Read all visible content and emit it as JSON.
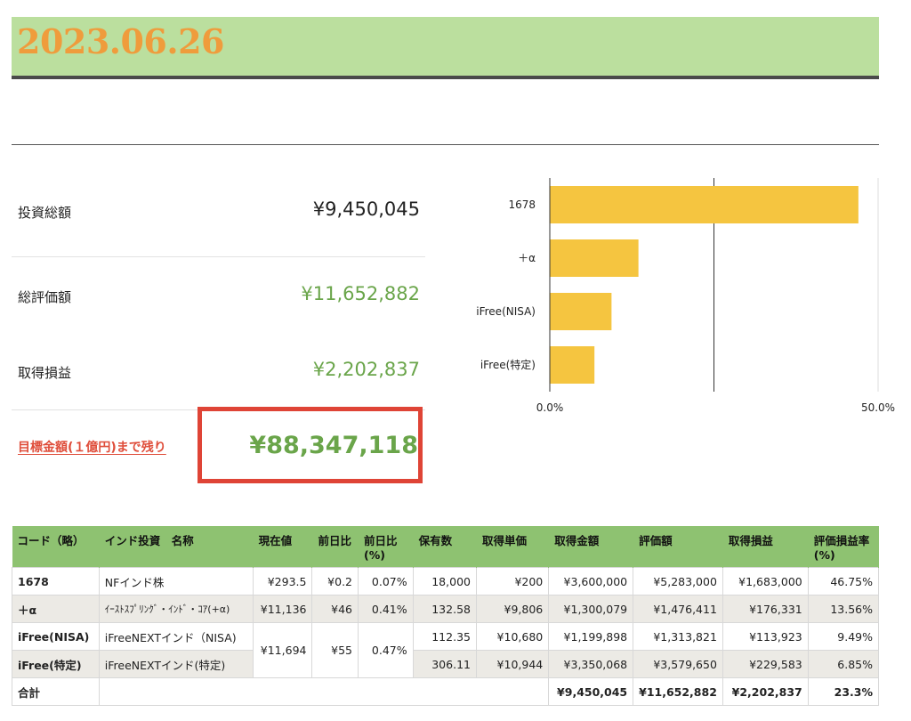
{
  "header": {
    "date": "2023.06.26"
  },
  "summary": {
    "invest_label": "投資総額",
    "invest_value": "¥9,450,045",
    "eval_label": "総評価額",
    "eval_value": "¥11,652,882",
    "gain_label": "取得損益",
    "gain_value": "¥2,202,837",
    "goal_label": "目標金額(１億円)まで残り",
    "goal_value": "¥88,347,118"
  },
  "chart_data": {
    "type": "bar",
    "orientation": "horizontal",
    "categories": [
      "1678",
      "＋α",
      "iFree(NISA)",
      "iFree(特定)"
    ],
    "values": [
      47.0,
      13.5,
      9.4,
      6.8
    ],
    "x_ticks": [
      "0.0%",
      "50.0%"
    ],
    "xlim": [
      0,
      50
    ],
    "color": "#f5c540",
    "gridline_at": 25
  },
  "table": {
    "headers": [
      "コード（略）",
      "インド投資　名称",
      "現在値",
      "前日比",
      "前日比\n(%)",
      "保有数",
      "取得単価",
      "取得金額",
      "評価額",
      "取得損益",
      "評価損益率\n(%)"
    ],
    "rows": [
      {
        "code": "1678",
        "name": "NFインド株",
        "price": "¥293.5",
        "diff": "¥0.2",
        "diff_pct": "0.07%",
        "qty": "18,000",
        "unit_cost": "¥200",
        "cost": "¥3,600,000",
        "value": "¥5,283,000",
        "gain": "¥1,683,000",
        "gain_pct": "46.75%"
      },
      {
        "code": "＋α",
        "name": "ｲｰｽﾄｽﾌﾟﾘﾝｸﾞ・ｲﾝﾄﾞ・ｺｱ(+α)",
        "price": "¥11,136",
        "diff": "¥46",
        "diff_pct": "0.41%",
        "qty": "132.58",
        "unit_cost": "¥9,806",
        "cost": "¥1,300,079",
        "value": "¥1,476,411",
        "gain": "¥176,331",
        "gain_pct": "13.56%"
      },
      {
        "code": "iFree(NISA)",
        "name": "iFreeNEXTインド（NISA)",
        "qty": "112.35",
        "unit_cost": "¥10,680",
        "cost": "¥1,199,898",
        "value": "¥1,313,821",
        "gain": "¥113,923",
        "gain_pct": "9.49%"
      },
      {
        "code": "iFree(特定)",
        "name": "iFreeNEXTインド(特定)",
        "qty": "306.11",
        "unit_cost": "¥10,944",
        "cost": "¥3,350,068",
        "value": "¥3,579,650",
        "gain": "¥229,583",
        "gain_pct": "6.85%"
      }
    ],
    "ifree_shared": {
      "price": "¥11,694",
      "diff": "¥55",
      "diff_pct": "0.47%"
    },
    "total": {
      "label": "合計",
      "cost": "¥9,450,045",
      "value": "¥11,652,882",
      "gain": "¥2,202,837",
      "gain_pct": "23.3%"
    }
  }
}
